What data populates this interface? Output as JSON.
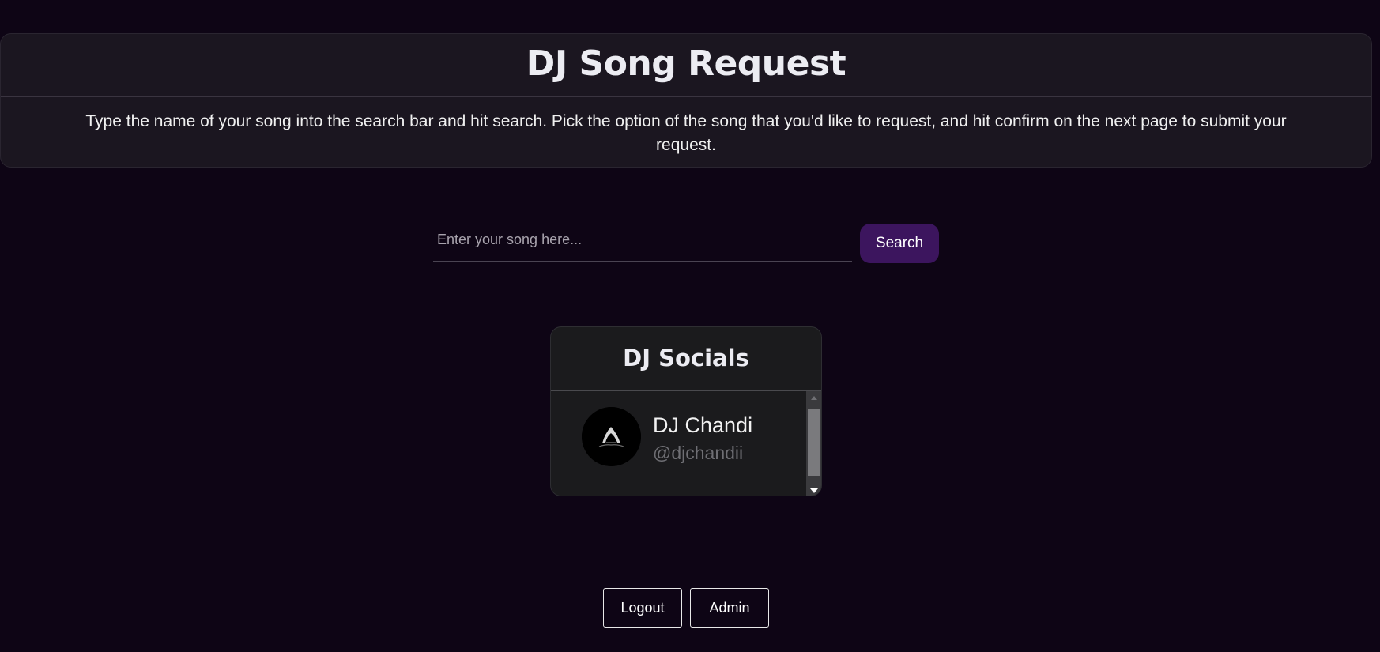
{
  "header": {
    "title": "DJ Song Request",
    "instructions": "Type the name of your song into the search bar and hit search. Pick the option of the song that you'd like to request, and hit confirm on the next page to submit your request."
  },
  "search": {
    "placeholder": "Enter your song here...",
    "value": "",
    "button_label": "Search"
  },
  "socials": {
    "title": "DJ Socials",
    "items": [
      {
        "name": "DJ Chandi",
        "handle": "@djchandii",
        "avatar_icon": "hooded-figure-icon"
      }
    ]
  },
  "footer": {
    "logout_label": "Logout",
    "admin_label": "Admin"
  },
  "colors": {
    "background": "#0e0515",
    "header_bg": "#1b1620",
    "accent": "#3c155e",
    "card_bg": "#1b1b1d"
  }
}
